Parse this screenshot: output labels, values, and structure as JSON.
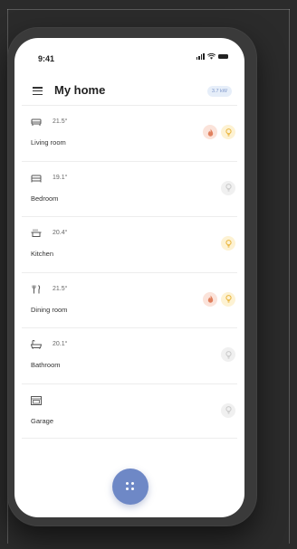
{
  "status_bar": {
    "time": "9:41"
  },
  "header": {
    "title": "My home",
    "power_badge": "3.7 kW"
  },
  "rooms": [
    {
      "icon": "sofa-icon",
      "temperature": "21.5°",
      "name": "Living room",
      "heating": true,
      "light": "on"
    },
    {
      "icon": "bed-icon",
      "temperature": "19.1°",
      "name": "Bedroom",
      "heating": false,
      "light": "off"
    },
    {
      "icon": "pot-icon",
      "temperature": "20.4°",
      "name": "Kitchen",
      "heating": false,
      "light": "on"
    },
    {
      "icon": "cutlery-icon",
      "temperature": "21.5°",
      "name": "Dining room",
      "heating": true,
      "light": "on"
    },
    {
      "icon": "bathtub-icon",
      "temperature": "20.1°",
      "name": "Bathroom",
      "heating": false,
      "light": "off"
    },
    {
      "icon": "garage-icon",
      "temperature": "",
      "name": "Garage",
      "heating": false,
      "light": "off"
    }
  ],
  "colors": {
    "accent": "#6e88c6",
    "flame": "#e0805e",
    "bulb_on": "#e9b43c",
    "bulb_off": "#c9c9c9",
    "background": "#2b2b2b"
  }
}
